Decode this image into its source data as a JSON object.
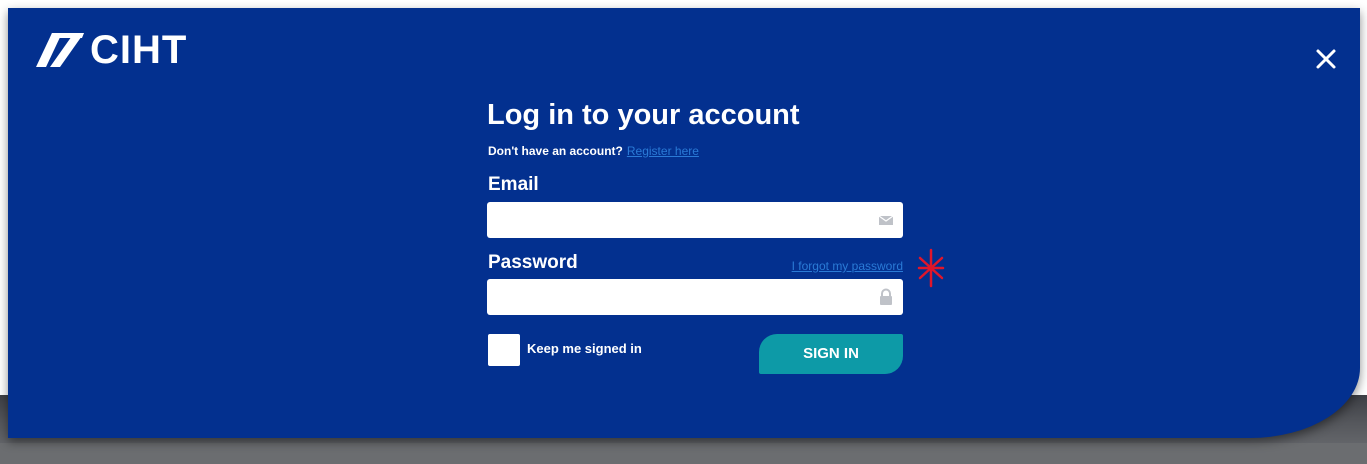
{
  "brand": {
    "name": "CIHT",
    "primary_color": "#03308f",
    "accent_color": "#0d9aa7",
    "link_color": "#2a7ad6"
  },
  "header": {
    "close_icon": "close-icon"
  },
  "login": {
    "title": "Log in to your account",
    "no_account_text": "Don't have an account?",
    "register_link": "Register here",
    "email_label": "Email",
    "email_value": "",
    "email_icon": "envelope-icon",
    "password_label": "Password",
    "forgot_link": "I forgot my password",
    "password_value": "",
    "password_icon": "lock-icon",
    "keep_signed_in_label": "Keep me signed in",
    "keep_signed_in_checked": false,
    "sign_in_label": "SIGN IN"
  }
}
